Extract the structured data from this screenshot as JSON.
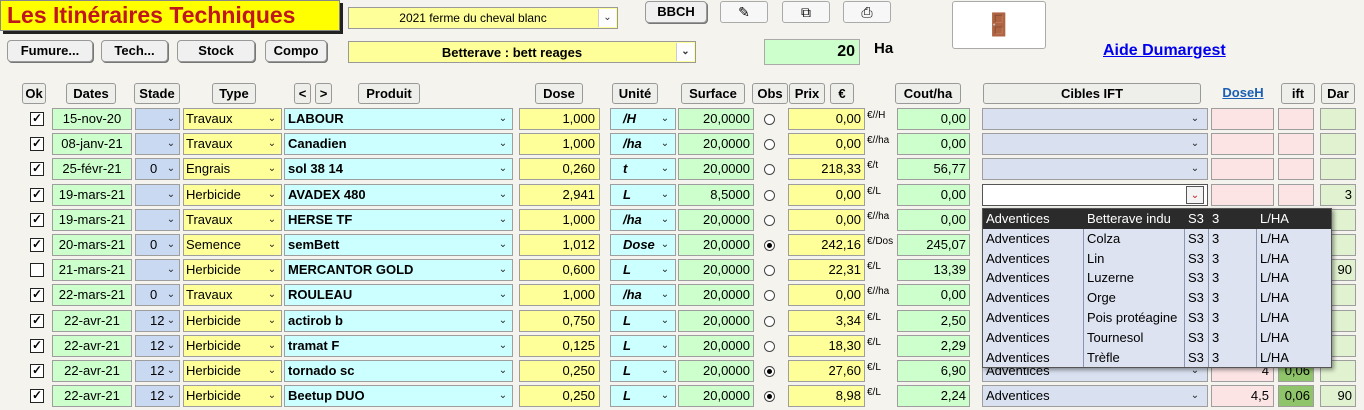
{
  "app": {
    "title": "Les Itinéraires Techniques"
  },
  "top": {
    "farm_select": "2021 ferme du cheval blanc",
    "bbch_label": "BBCH",
    "buttons": [
      "Fumure...",
      "Tech...",
      "Stock",
      "Compo"
    ],
    "culture_select": "Betterave : bett reages",
    "surface_value": "20",
    "surface_unit": "Ha",
    "help_link": "Aide Dumargest",
    "icons": {
      "edit": "edit-icon",
      "copy": "copy-icon",
      "print": "print-icon",
      "exit": "exit-door-icon"
    }
  },
  "columns": {
    "ok": "Ok",
    "dates": "Dates",
    "stade": "Stade",
    "type": "Type",
    "prev": "<",
    "next": ">",
    "produit": "Produit",
    "dose": "Dose",
    "unite": "Unité",
    "surface": "Surface",
    "obs": "Obs",
    "prix": "Prix",
    "euro": "€",
    "cout": "Cout/ha",
    "cibles": "Cibles IFT",
    "doseh": "DoseH",
    "ift": "ift",
    "dar": "Dar"
  },
  "rows": [
    {
      "ok": true,
      "date": "15-nov-20",
      "stade": "",
      "type": "Travaux",
      "produit": "LABOUR",
      "dose": "1,000",
      "unite": "/H",
      "surface": "20,0000",
      "obs": false,
      "prix": "0,00",
      "prix_unit": "€//H",
      "cout": "0,00",
      "cible": "",
      "doseh": "",
      "ift": "",
      "dar": ""
    },
    {
      "ok": true,
      "date": "08-janv-21",
      "stade": "",
      "type": "Travaux",
      "produit": "Canadien",
      "dose": "1,000",
      "unite": "/ha",
      "surface": "20,0000",
      "obs": false,
      "prix": "0,00",
      "prix_unit": "€//ha",
      "cout": "0,00",
      "cible": "",
      "doseh": "",
      "ift": "",
      "dar": ""
    },
    {
      "ok": true,
      "date": "25-févr-21",
      "stade": "0",
      "type": "Engrais",
      "produit": "sol 38 14",
      "dose": "0,260",
      "unite": "t",
      "surface": "20,0000",
      "obs": false,
      "prix": "218,33",
      "prix_unit": "€/t",
      "cout": "56,77",
      "cible": "",
      "doseh": "",
      "ift": "",
      "dar": ""
    },
    {
      "ok": true,
      "date": "19-mars-21",
      "stade": "",
      "type": "Herbicide",
      "produit": "AVADEX 480",
      "dose": "2,941",
      "unite": "L",
      "surface": "8,5000",
      "obs": false,
      "prix": "0,00",
      "prix_unit": "€/L",
      "cout": "0,00",
      "cible": "",
      "doseh": "",
      "ift": "",
      "dar": "3"
    },
    {
      "ok": true,
      "date": "19-mars-21",
      "stade": "",
      "type": "Travaux",
      "produit": "HERSE TF",
      "dose": "1,000",
      "unite": "/ha",
      "surface": "20,0000",
      "obs": false,
      "prix": "0,00",
      "prix_unit": "€//ha",
      "cout": "0,00",
      "cible": "",
      "doseh": "",
      "ift": "",
      "dar": ""
    },
    {
      "ok": true,
      "date": "20-mars-21",
      "stade": "0",
      "type": "Semence",
      "produit": "semBett",
      "dose": "1,012",
      "unite": "Dose",
      "surface": "20,0000",
      "obs": true,
      "prix": "242,16",
      "prix_unit": "€/Dos",
      "cout": "245,07",
      "cible": "",
      "doseh": "",
      "ift": "",
      "dar": ""
    },
    {
      "ok": false,
      "date": "21-mars-21",
      "stade": "",
      "type": "Herbicide",
      "produit": "MERCANTOR GOLD",
      "dose": "0,600",
      "unite": "L",
      "surface": "20,0000",
      "obs": false,
      "prix": "22,31",
      "prix_unit": "€/L",
      "cout": "13,39",
      "cible": "",
      "doseh": "",
      "ift": "",
      "dar": "90"
    },
    {
      "ok": true,
      "date": "22-mars-21",
      "stade": "0",
      "type": "Travaux",
      "produit": "ROULEAU",
      "dose": "1,000",
      "unite": "/ha",
      "surface": "20,0000",
      "obs": false,
      "prix": "0,00",
      "prix_unit": "€//ha",
      "cout": "0,00",
      "cible": "",
      "doseh": "",
      "ift": "",
      "dar": ""
    },
    {
      "ok": true,
      "date": "22-avr-21",
      "stade": "12",
      "type": "Herbicide",
      "produit": "actirob b",
      "dose": "0,750",
      "unite": "L",
      "surface": "20,0000",
      "obs": false,
      "prix": "3,34",
      "prix_unit": "€/L",
      "cout": "2,50",
      "cible": "",
      "doseh": "",
      "ift": "",
      "dar": ""
    },
    {
      "ok": true,
      "date": "22-avr-21",
      "stade": "12",
      "type": "Herbicide",
      "produit": "tramat F",
      "dose": "0,125",
      "unite": "L",
      "surface": "20,0000",
      "obs": false,
      "prix": "18,30",
      "prix_unit": "€/L",
      "cout": "2,29",
      "cible": "",
      "doseh": "",
      "ift": "",
      "dar": ""
    },
    {
      "ok": true,
      "date": "22-avr-21",
      "stade": "12",
      "type": "Herbicide",
      "produit": "tornado sc",
      "dose": "0,250",
      "unite": "L",
      "surface": "20,0000",
      "obs": true,
      "prix": "27,60",
      "prix_unit": "€/L",
      "cout": "6,90",
      "cible": "Adventices",
      "doseh": "4",
      "ift": "0,06",
      "dar": ""
    },
    {
      "ok": true,
      "date": "22-avr-21",
      "stade": "12",
      "type": "Herbicide",
      "produit": "Beetup DUO",
      "dose": "0,250",
      "unite": "L",
      "surface": "20,0000",
      "obs": true,
      "prix": "8,98",
      "prix_unit": "€/L",
      "cout": "2,24",
      "cible": "Adventices",
      "doseh": "4,5",
      "ift": "0,06",
      "dar": "90"
    }
  ],
  "ift_popup": {
    "rows": [
      [
        "Adventices",
        "Betterave indu",
        "S3",
        "3",
        "L/HA"
      ],
      [
        "Adventices",
        "Colza",
        "S3",
        "3",
        "L/HA"
      ],
      [
        "Adventices",
        "Lin",
        "S3",
        "3",
        "L/HA"
      ],
      [
        "Adventices",
        "Luzerne",
        "S3",
        "3",
        "L/HA"
      ],
      [
        "Adventices",
        "Orge",
        "S3",
        "3",
        "L/HA"
      ],
      [
        "Adventices",
        "Pois protéagine",
        "S3",
        "3",
        "L/HA"
      ],
      [
        "Adventices",
        "Tournesol",
        "S3",
        "3",
        "L/HA"
      ],
      [
        "Adventices",
        "Trèfle",
        "S3",
        "3",
        "L/HA"
      ]
    ],
    "selected_index": 0
  }
}
